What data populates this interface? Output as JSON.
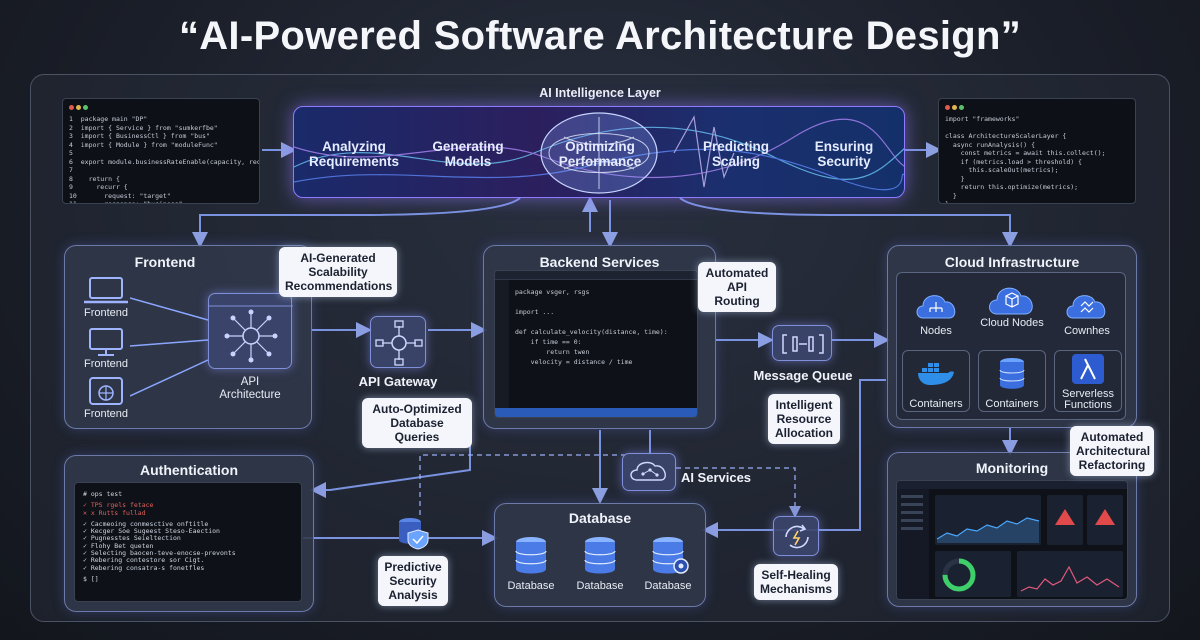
{
  "title": "“AI-Powered Software Architecture Design”",
  "ai_layer": {
    "label": "AI Intelligence Layer",
    "steps": [
      "Analyzing Requirements",
      "Generating Models",
      "Optimizing Performance",
      "Predicting Scaling",
      "Ensuring Security"
    ]
  },
  "frontend": {
    "title": "Frontend",
    "devices": [
      "Frontend",
      "Frontend",
      "Frontend"
    ],
    "api_architecture": "API Architecture"
  },
  "api_gateway": "API Gateway",
  "backend": {
    "title": "Backend Services"
  },
  "message_queue": "Message Queue",
  "cloud": {
    "title": "Cloud Infrastructure",
    "nodes": [
      "Nodes",
      "Cloud Nodes",
      "Cownhes"
    ],
    "services": [
      "Containers",
      "Containers",
      "Serverless Functions"
    ]
  },
  "authentication": {
    "title": "Authentication",
    "terminal_lines": [
      "# ops test",
      "",
      "✓ TPS rgels fetace",
      "✕ x Rutts fullad",
      "",
      "✓ Cacmeoing conmesctive onftitle",
      "✓ Kecger Soe Sugeest Steso-Eaection",
      "✓ Pugnesstes Seieltection",
      "✓ Flohy Bet queten",
      "✓ Selecting baocen-teve-enocse-prevonts",
      "✓ Rebering contestore sor Cigt.",
      "✓ Rebering consatra-s fonetfles",
      "",
      "$ []"
    ]
  },
  "ai_services": "AI Services",
  "database": {
    "title": "Database",
    "items": [
      "Database",
      "Database",
      "Database"
    ]
  },
  "monitoring": {
    "title": "Monitoring"
  },
  "callouts": {
    "scalability": "AI-Generated Scalability Recommendations",
    "routing": "Automated API Routing",
    "db_queries": "Auto-Optimized Database Queries",
    "resource": "Intelligent Resource Allocation",
    "refactoring": "Automated Architectural Refactoring",
    "security": "Predictive Security Analysis",
    "self_healing": "Self-Healing Mechanisms"
  },
  "colors": {
    "accent": "#8f7bff",
    "glow": "#6fa8ff",
    "panel": "#30384a"
  }
}
